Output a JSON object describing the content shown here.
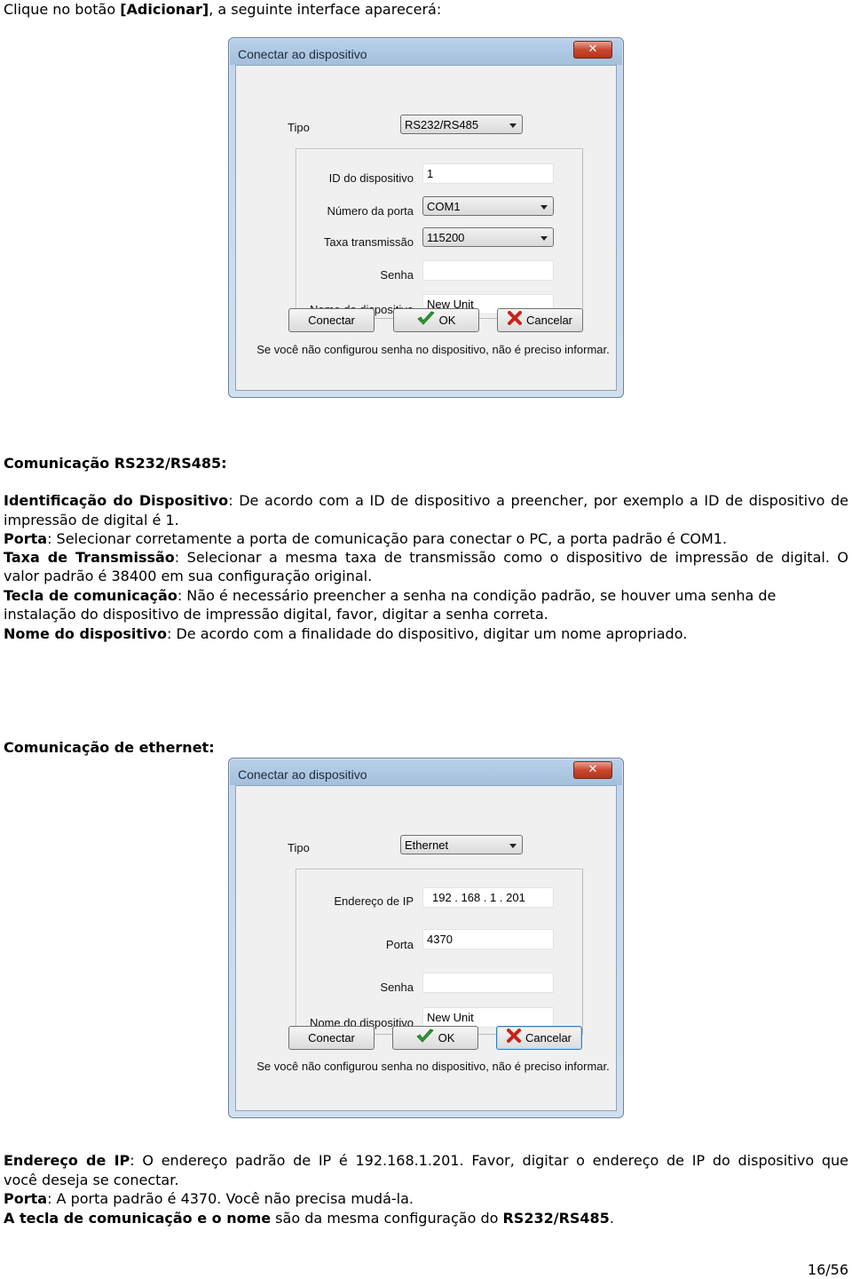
{
  "intro": {
    "pre": "Clique no botão ",
    "bold": "[Adicionar]",
    "post": ", a seguinte interface aparecerá:"
  },
  "dialog_common": {
    "title": "Conectar ao dispositivo",
    "close_icon": "close-icon",
    "tipo_label": "Tipo",
    "senha_label": "Senha",
    "nome_label": "Nome do dispositivo",
    "conectar_label": "Conectar",
    "ok_label": "OK",
    "cancelar_label": "Cancelar",
    "note": "Se você não configurou senha no dispositivo, não é preciso informar."
  },
  "dialog1": {
    "tipo": "RS232/RS485",
    "id_label": "ID do dispositivo",
    "id_value": "1",
    "porta_label": "Número da porta",
    "porta_value": "COM1",
    "taxa_label": "Taxa transmissão",
    "taxa_value": "115200",
    "senha_value": "",
    "nome_value": "New Unit"
  },
  "section1": {
    "heading": "Comunicação RS232/RS485:",
    "items": [
      {
        "term": "Identificação do Dispositivo",
        "line1": ": De acordo com a ID de dispositivo a preencher, por exemplo a ID de dispositivo de",
        "line2": "impressão de digital é 1."
      },
      {
        "term": "Porta",
        "line1": ":  Selecionar corretamente a porta de comunicação para conectar o PC, a porta padrão é COM1."
      },
      {
        "term": "Taxa de Transmissão",
        "line1": ": Selecionar a mesma taxa de transmissão como o dispositivo de impressão de digital. O",
        "line2": "valor padrão é 38400 em sua configuração original."
      },
      {
        "term": "Tecla de comunicação",
        "line1": ": Não é necessário preencher a senha na condição padrão, se houver uma senha de",
        "line2": "instalação do dispositivo de impressão digital, favor, digitar a senha correta."
      },
      {
        "term": "Nome do dispositivo",
        "line1": ":  De acordo com a finalidade do dispositivo, digitar um nome apropriado."
      }
    ]
  },
  "section2": {
    "heading": "Comunicação de ethernet:"
  },
  "dialog2": {
    "tipo": "Ethernet",
    "ip_label": "Endereço de IP",
    "ip_value": "192 . 168 .  1   . 201",
    "porta_label": "Porta",
    "porta_value": "4370",
    "senha_value": "",
    "nome_value": "New Unit"
  },
  "section2_text": {
    "ip_term": "Endereço de IP",
    "ip_line1": ":  O endereço padrão de IP é 192.168.1.201.  Favor, digitar o endereço de IP do dispositivo que",
    "ip_line2": "você deseja se conectar.",
    "porta_term": "Porta",
    "porta_line": ": A porta padrão é 4370. Você não precisa mudá-la.",
    "last_bold1": "A tecla de comunicação e o nome",
    "last_mid": " são da mesma configuração do ",
    "last_bold2": "RS232/RS485",
    "last_end": "."
  },
  "page_number": "16/56"
}
